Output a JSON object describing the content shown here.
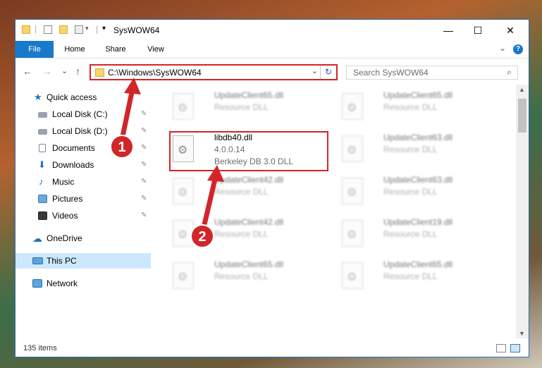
{
  "window": {
    "title": "SysWOW64",
    "minimize_icon": "—",
    "maximize_icon": "☐",
    "close_icon": "✕"
  },
  "ribbon": {
    "tabs": [
      "File",
      "Home",
      "Share",
      "View"
    ],
    "collapse_icon": "⌄",
    "help_icon": "?"
  },
  "nav": {
    "back_icon": "←",
    "forward_icon": "→",
    "recent_icon": "⌄",
    "up_icon": "↑",
    "address": "C:\\Windows\\SysWOW64",
    "dropdown_icon": "⌄",
    "refresh_icon": "↻",
    "search_placeholder": "Search SysWOW64",
    "search_icon": "⌕"
  },
  "sidebar": {
    "quick_access": "Quick access",
    "items": [
      {
        "label": "Local Disk (C:)",
        "icon": "drive-icon"
      },
      {
        "label": "Local Disk (D:)",
        "icon": "drive-icon"
      },
      {
        "label": "Documents",
        "icon": "documents-icon"
      },
      {
        "label": "Downloads",
        "icon": "downloads-icon"
      },
      {
        "label": "Music",
        "icon": "music-icon"
      },
      {
        "label": "Pictures",
        "icon": "pictures-icon"
      },
      {
        "label": "Videos",
        "icon": "videos-icon"
      }
    ],
    "pin_icon": "✎",
    "onedrive": "OneDrive",
    "this_pc": "This PC",
    "network": "Network"
  },
  "files": [
    {
      "name": "UpdateClient65.dll",
      "line2": "Resource DLL",
      "line3": ""
    },
    {
      "name": "UpdateClient65.dll",
      "line2": "Resource DLL",
      "line3": ""
    },
    {
      "name": "libdb40.dll",
      "line2": "4.0.0.14",
      "line3": "Berkeley DB 3.0 DLL"
    },
    {
      "name": "UpdateClient63.dll",
      "line2": "Resource DLL",
      "line3": ""
    },
    {
      "name": "UpdateClient42.dll",
      "line2": "Resource DLL",
      "line3": ""
    },
    {
      "name": "UpdateClient63.dll",
      "line2": "Resource DLL",
      "line3": ""
    },
    {
      "name": "UpdateClient42.dll",
      "line2": "Resource DLL",
      "line3": ""
    },
    {
      "name": "UpdateClient19.dll",
      "line2": "Resource DLL",
      "line3": ""
    },
    {
      "name": "UpdateClient65.dll",
      "line2": "Resource DLL",
      "line3": ""
    },
    {
      "name": "UpdateClient65.dll",
      "line2": "Resource DLL",
      "line3": ""
    }
  ],
  "gear_icon": "⚙",
  "status": {
    "items_count": "135 items"
  },
  "annotations": {
    "badge1": "1",
    "badge2": "2",
    "highlight_color": "#d2252a"
  }
}
